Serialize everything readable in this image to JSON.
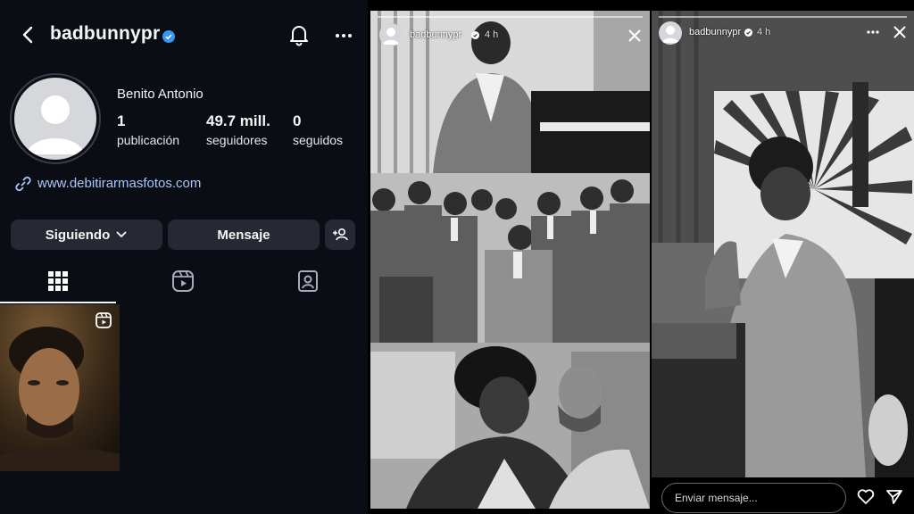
{
  "profile": {
    "username": "badbunnypr",
    "display_name": "Benito Antonio",
    "stats": [
      {
        "value": "1",
        "label": "publicación"
      },
      {
        "value": "49.7 mill.",
        "label": "seguidores"
      },
      {
        "value": "0",
        "label": "seguidos"
      }
    ],
    "link": "www.debitirarmasfotos.com",
    "buttons": {
      "following": "Siguiendo",
      "message": "Mensaje"
    },
    "tabs": [
      "grid-icon",
      "reels-icon",
      "tagged-icon"
    ],
    "icons": [
      "back-icon",
      "verified-icon",
      "bell-icon",
      "more-icon",
      "link-icon",
      "add-person-icon",
      "reel-icon"
    ],
    "accent": "#3897f0",
    "link_color": "#a8c7fa"
  },
  "story1": {
    "username": "badbunnypr",
    "time": "4 h"
  },
  "story2": {
    "username": "badbunnypr",
    "time": "4 h",
    "message_placeholder": "Enviar mensaje..."
  }
}
